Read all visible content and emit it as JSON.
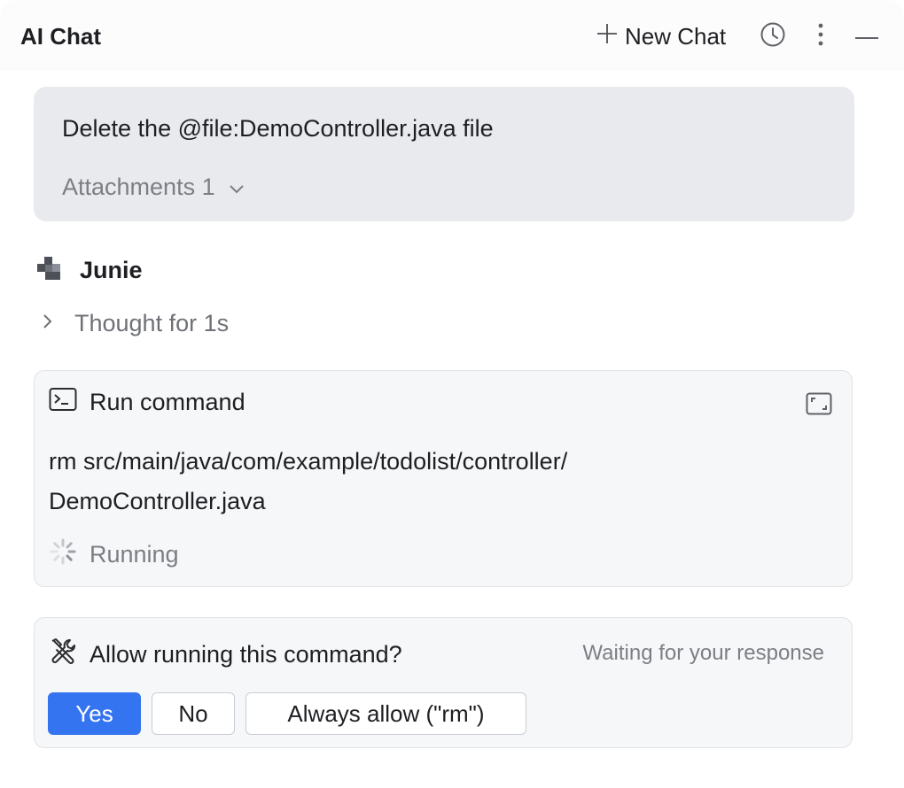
{
  "header": {
    "title": "AI Chat",
    "new_chat_label": "New Chat"
  },
  "icons": {
    "new_chat": "plus-icon",
    "history": "clock-icon",
    "more": "more-vertical-icon",
    "minimize": "minimize-icon",
    "agent": "junie-logo-icon",
    "thought": "chevron-right-icon",
    "attachments": "chevron-down-icon",
    "terminal": "terminal-icon",
    "expand": "expand-icon",
    "running": "spinner-icon",
    "allow": "tools-icon"
  },
  "user_message": {
    "text": "Delete the @file:DemoController.java file",
    "attachments_label": "Attachments 1"
  },
  "agent": {
    "name": "Junie",
    "thought_label": "Thought for 1s"
  },
  "run_command": {
    "title": "Run command",
    "command_line1": "rm src/main/java/com/example/todolist/controller/",
    "command_line2": "DemoController.java",
    "status": "Running"
  },
  "permission": {
    "question": "Allow running this command?",
    "status": "Waiting for your response",
    "yes_label": "Yes",
    "no_label": "No",
    "always_label": "Always allow (\"rm\")"
  },
  "colors": {
    "accent": "#3574f0",
    "user_bubble": "#e9eaee",
    "card_bg": "#f6f7f9",
    "muted_text": "#7c7e84"
  }
}
